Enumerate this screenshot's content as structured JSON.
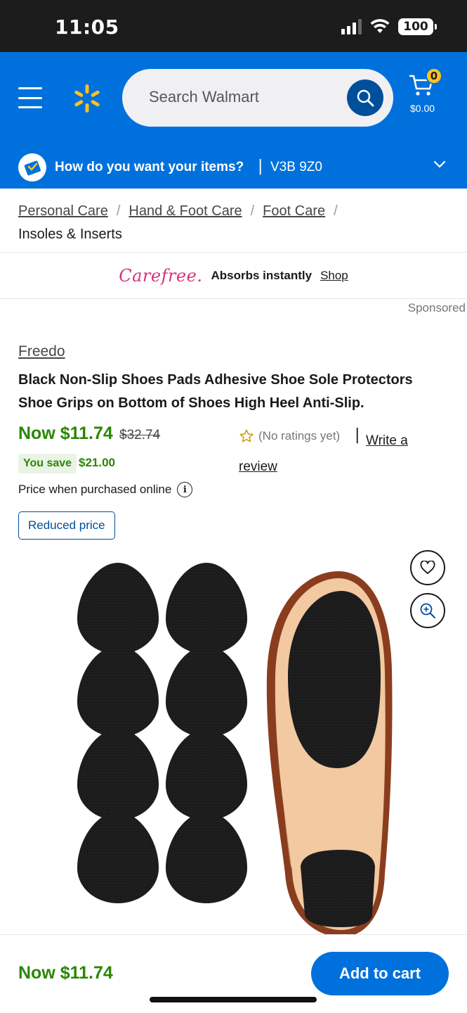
{
  "status_bar": {
    "time": "11:05",
    "battery": "100"
  },
  "header": {
    "search_placeholder": "Search Walmart",
    "cart_count": "0",
    "cart_total": "$0.00"
  },
  "delivery": {
    "question": "How do you want your items?",
    "separator": "|",
    "postal_code": "V3B 9Z0"
  },
  "breadcrumb": {
    "items": [
      "Personal Care",
      "Hand & Foot Care",
      "Foot Care"
    ],
    "separator": "/",
    "current": "Insoles & Inserts"
  },
  "ad": {
    "brand": "Carefree.",
    "text": "Absorbs instantly",
    "cta": "Shop",
    "sponsored_label": "Sponsored"
  },
  "product": {
    "brand": "Freedo",
    "title": "Black Non-Slip Shoes Pads Adhesive Shoe Sole Protectors Shoe Grips on Bottom of Shoes High Heel Anti-Slip.",
    "price_now": "Now $11.74",
    "price_was": "$32.74",
    "save_label": "You save",
    "save_amount": "$21.00",
    "price_note": "Price when purchased online",
    "rating_text": "(No ratings yet)",
    "rating_sep": "|",
    "review_link": "Write a review",
    "badge": "Reduced price"
  },
  "bottom_bar": {
    "price": "Now $11.74",
    "add_to_cart": "Add to cart"
  },
  "colors": {
    "walmart_blue": "#0071dc",
    "spark_yellow": "#ffc220",
    "price_green": "#2a8703",
    "dark_blue": "#004f9a"
  },
  "icons": [
    "menu-icon",
    "spark-logo-icon",
    "search-icon",
    "cart-icon",
    "delivery-icon",
    "chevron-down-icon",
    "star-icon",
    "info-icon",
    "heart-icon",
    "zoom-icon"
  ]
}
